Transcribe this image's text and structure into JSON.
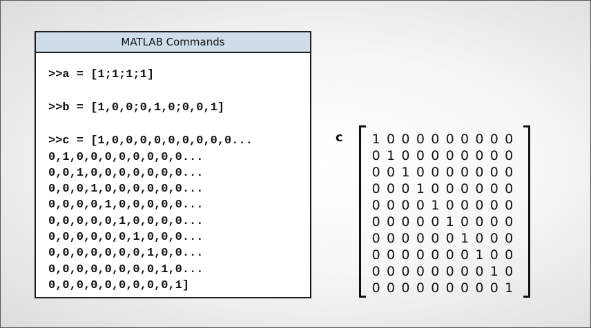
{
  "panel": {
    "title": "MATLAB Commands",
    "commands": [
      ">>a = [1;1;1;1]",
      ">>b = [1,0,0;0,1,0;0,0,1]",
      ">>c = [1,0,0,0,0,0,0,0,0,0...",
      "0,1,0,0,0,0,0,0,0,0...",
      "0,0,1,0,0,0,0,0,0,0...",
      "0,0,0,1,0,0,0,0,0,0...",
      "0,0,0,0,1,0,0,0,0,0...",
      "0,0,0,0,0,1,0,0,0,0...",
      "0,0,0,0,0,0,1,0,0,0...",
      "0,0,0,0,0,0,0,1,0,0...",
      "0,0,0,0,0,0,0,0,1,0...",
      "0,0,0,0,0,0,0,0,0,1]"
    ]
  },
  "matrix": {
    "label": "c",
    "rows": [
      [
        "1",
        "0",
        "0",
        "0",
        "0",
        "0",
        "0",
        "0",
        "0",
        "0"
      ],
      [
        "0",
        "1",
        "0",
        "0",
        "0",
        "0",
        "0",
        "0",
        "0",
        "0"
      ],
      [
        "0",
        "0",
        "1",
        "0",
        "0",
        "0",
        "0",
        "0",
        "0",
        "0"
      ],
      [
        "0",
        "0",
        "0",
        "1",
        "0",
        "0",
        "0",
        "0",
        "0",
        "0"
      ],
      [
        "0",
        "0",
        "0",
        "0",
        "1",
        "0",
        "0",
        "0",
        "0",
        "0"
      ],
      [
        "0",
        "0",
        "0",
        "0",
        "0",
        "1",
        "0",
        "0",
        "0",
        "0"
      ],
      [
        "0",
        "0",
        "0",
        "0",
        "0",
        "0",
        "1",
        "0",
        "0",
        "0"
      ],
      [
        "0",
        "0",
        "0",
        "0",
        "0",
        "0",
        "0",
        "1",
        "0",
        "0"
      ],
      [
        "0",
        "0",
        "0",
        "0",
        "0",
        "0",
        "0",
        "0",
        "1",
        "0"
      ],
      [
        "0",
        "0",
        "0",
        "0",
        "0",
        "0",
        "0",
        "0",
        "0",
        "1"
      ]
    ]
  }
}
